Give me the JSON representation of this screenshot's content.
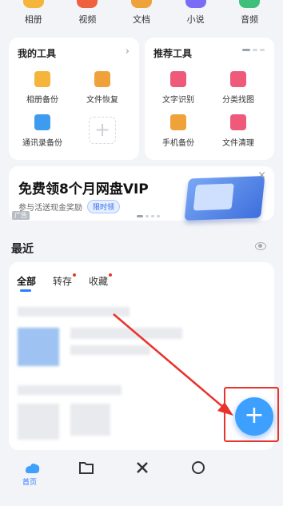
{
  "top_nav": [
    {
      "label": "相册",
      "icon": "album-icon",
      "color": "#f5b53b"
    },
    {
      "label": "视频",
      "icon": "video-icon",
      "color": "#f0603e"
    },
    {
      "label": "文档",
      "icon": "document-icon",
      "color": "#f0a23a"
    },
    {
      "label": "小说",
      "icon": "novel-icon",
      "color": "#7b6cf5"
    },
    {
      "label": "音频",
      "icon": "audio-icon",
      "color": "#3ec07b"
    }
  ],
  "my_tools": {
    "title": "我的工具",
    "chevron": "›",
    "items": [
      {
        "label": "相册备份",
        "icon": "photo-backup-icon",
        "color": "#f5b53b"
      },
      {
        "label": "文件恢复",
        "icon": "file-restore-icon",
        "color": "#f0a23a"
      },
      {
        "label": "通讯录备份",
        "icon": "contacts-backup-icon",
        "color": "#3d9cf0"
      }
    ],
    "add": "+"
  },
  "recommended_tools": {
    "title": "推荐工具",
    "items": [
      {
        "label": "文字识别",
        "icon": "text-recognition-icon",
        "color": "#ef5a7a"
      },
      {
        "label": "分类找图",
        "icon": "image-category-icon",
        "color": "#ef5a7a"
      },
      {
        "label": "手机备份",
        "icon": "phone-backup-icon",
        "color": "#f0a23a"
      },
      {
        "label": "文件清理",
        "icon": "file-clean-icon",
        "color": "#ef5a7a"
      }
    ]
  },
  "banner": {
    "title": "免费领8个月网盘VIP",
    "subtitle": "参与活送现金奖励",
    "pill": "限时领",
    "ad": "广告",
    "close": "×"
  },
  "recent": {
    "title": "最近",
    "tabs": [
      "全部",
      "转存",
      "收藏"
    ]
  },
  "fab": {
    "label": "+",
    "color": "#3da0ff"
  },
  "bottom_nav": {
    "home_label": "首页"
  },
  "colors": {
    "accent": "#2d7dff",
    "highlight": "#e8342c"
  }
}
